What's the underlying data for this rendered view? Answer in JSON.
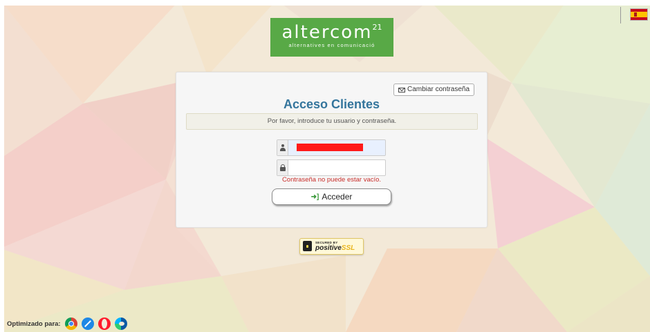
{
  "logo": {
    "text": "altercom",
    "superscript": "21",
    "tagline": "alternatives en comunicació",
    "color": "#58a946"
  },
  "language": {
    "flag": "spain-flag",
    "label": "Español"
  },
  "panel": {
    "change_password_label": "Cambiar contraseña",
    "title": "Acceso Clientes",
    "notice": "Por favor, introduce tu usuario y contraseña.",
    "username": {
      "value": "",
      "icon": "user-icon"
    },
    "password": {
      "value": "",
      "placeholder": "",
      "icon": "lock-icon"
    },
    "error": "Contraseña no puede estar vacío.",
    "submit_label": "Acceder"
  },
  "ssl_badge": {
    "secured_by": "SECURED BY",
    "brand": "positive",
    "brand_suffix": "SSL"
  },
  "footer": {
    "optimized_label": "Optimizado para:",
    "browsers": [
      "chrome-icon",
      "safari-icon",
      "opera-icon",
      "edge-icon"
    ]
  },
  "colors": {
    "title": "#34759c",
    "error": "#c9302c",
    "redaction": "#ff1a1a"
  }
}
